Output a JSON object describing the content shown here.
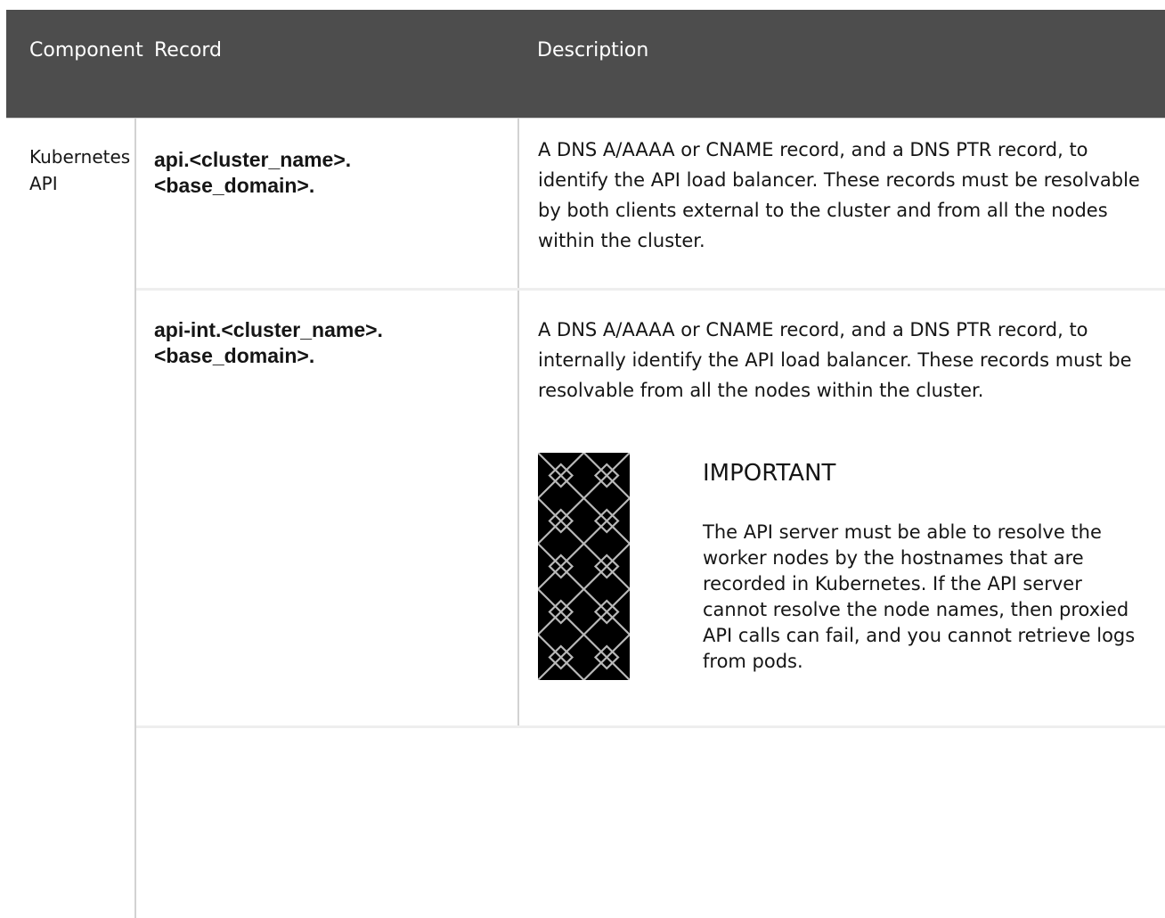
{
  "table": {
    "headers": {
      "component": "Component",
      "record": "Record",
      "description": "Description"
    },
    "rows": [
      {
        "component": "Kubernetes API",
        "record": "api.<cluster_name>.<base_domain>.",
        "description": "A DNS A/AAAA or CNAME record, and a DNS PTR record, to identify the API load balancer. These records must be resolvable by both clients external to the cluster and from all the nodes within the cluster."
      },
      {
        "record": "api-int.<cluster_name>.<base_domain>.",
        "description": "A DNS A/AAAA or CNAME record, and a DNS PTR record, to internally identify the API load balancer. These records must be resolvable from all the nodes within the cluster.",
        "admonition": {
          "icon": "important-pattern-icon",
          "title": "IMPORTANT",
          "text": "The API server must be able to resolve the worker nodes by the hostnames that are recorded in Kubernetes. If the API server cannot resolve the node names, then proxied API calls can fail, and you cannot retrieve logs from pods."
        }
      }
    ]
  },
  "colors": {
    "header_bg": "#4d4d4d",
    "header_text": "#ffffff",
    "body_text": "#151515",
    "border": "#d2d2d2",
    "icon_bg": "#000000"
  }
}
